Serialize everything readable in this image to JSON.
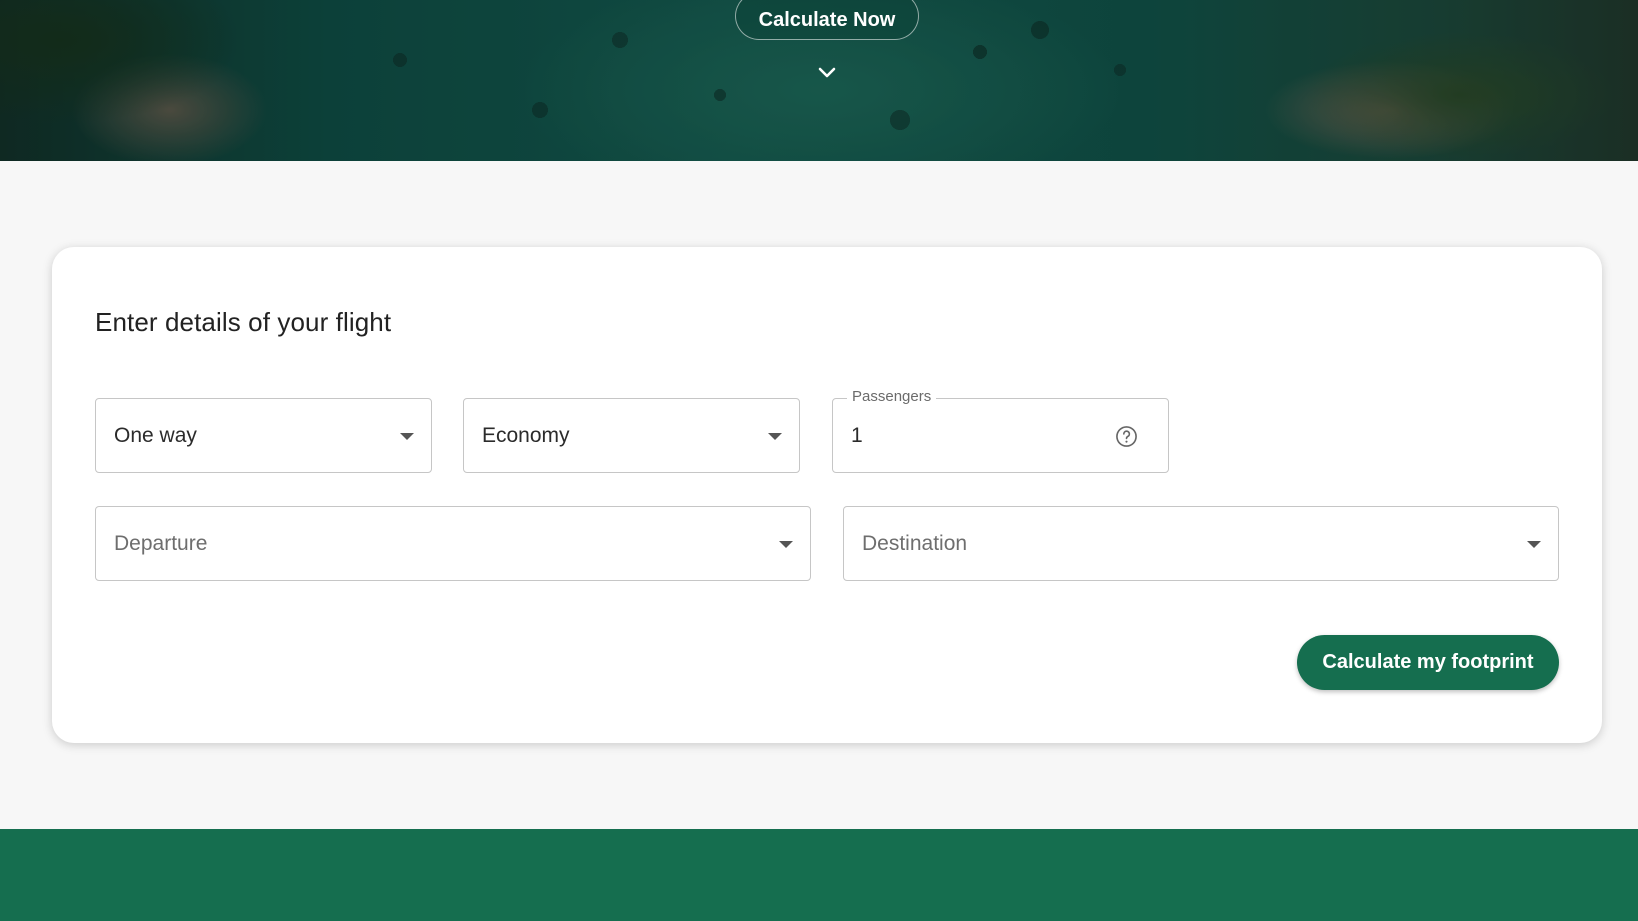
{
  "hero": {
    "cta_label": "Calculate Now",
    "chevron_icon": "chevron-down-icon"
  },
  "form": {
    "title": "Enter details of your flight",
    "trip_type": {
      "value": "One way"
    },
    "cabin_class": {
      "value": "Economy"
    },
    "passengers": {
      "label": "Passengers",
      "value": "1",
      "help_icon": "help-circle-icon"
    },
    "departure": {
      "placeholder": "Departure"
    },
    "destination": {
      "placeholder": "Destination"
    },
    "submit_label": "Calculate my footprint"
  },
  "colors": {
    "brand_green": "#156e4f",
    "page_background": "#f7f7f7",
    "card_background": "#ffffff"
  }
}
